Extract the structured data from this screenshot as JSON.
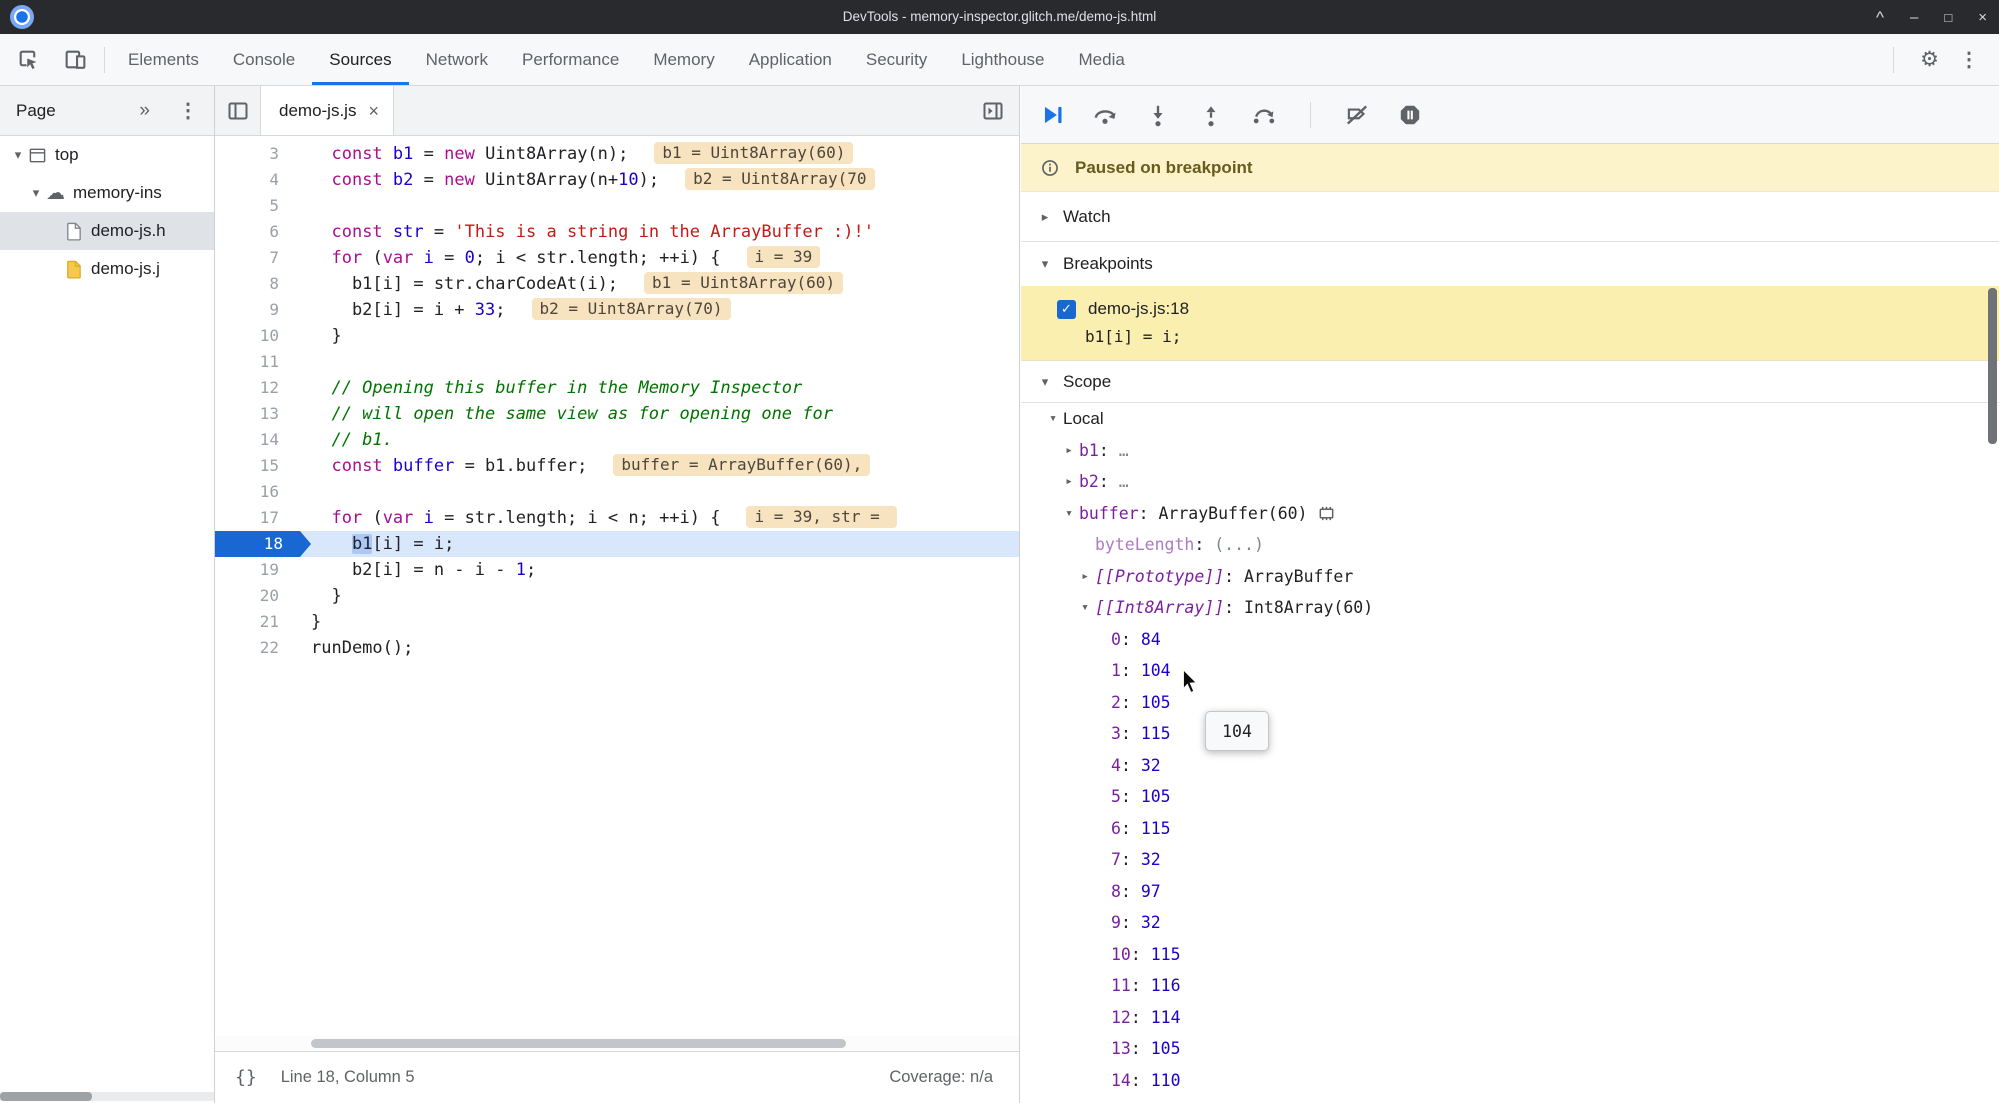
{
  "window": {
    "title": "DevTools - memory-inspector.glitch.me/demo-js.html"
  },
  "colors": {
    "accent": "#1a73e8",
    "paused_banner_bg": "#fcf3cb",
    "breakpoint_item_bg": "#faefae",
    "eval_badge_bg": "#f8e3c1",
    "current_line_bg": "#d9e7fd"
  },
  "main_toolbar": {
    "tabs": [
      "Elements",
      "Console",
      "Sources",
      "Network",
      "Performance",
      "Memory",
      "Application",
      "Security",
      "Lighthouse",
      "Media"
    ],
    "active_tab": "Sources"
  },
  "sidebar": {
    "tab_label": "Page",
    "tree": [
      {
        "label": "top",
        "icon": "frame",
        "indent": 0,
        "arrow": "down",
        "selected": false
      },
      {
        "label": "memory-ins",
        "icon": "cloud",
        "indent": 1,
        "arrow": "down",
        "selected": false
      },
      {
        "label": "demo-js.h",
        "icon": "file",
        "indent": 2,
        "arrow": "none",
        "selected": true
      },
      {
        "label": "demo-js.j",
        "icon": "file-js",
        "indent": 2,
        "arrow": "none",
        "selected": false
      }
    ]
  },
  "editor": {
    "tab_label": "demo-js.js",
    "status": {
      "position": "Line 18, Column 5",
      "coverage": "Coverage: n/a"
    },
    "lines": [
      {
        "num": 3,
        "tokens": [
          [
            "pl",
            "  "
          ],
          [
            "kw",
            "const"
          ],
          [
            "pl",
            " "
          ],
          [
            "def",
            "b1"
          ],
          [
            "pl",
            " = "
          ],
          [
            "kw",
            "new"
          ],
          [
            "pl",
            " Uint8Array(n);"
          ]
        ],
        "badge": "b1 = Uint8Array(60)"
      },
      {
        "num": 4,
        "tokens": [
          [
            "pl",
            "  "
          ],
          [
            "kw",
            "const"
          ],
          [
            "pl",
            " "
          ],
          [
            "def",
            "b2"
          ],
          [
            "pl",
            " = "
          ],
          [
            "kw",
            "new"
          ],
          [
            "pl",
            " Uint8Array(n+"
          ],
          [
            "num",
            "10"
          ],
          [
            "pl",
            ");"
          ]
        ],
        "badge": "b2 = Uint8Array(70"
      },
      {
        "num": 5,
        "tokens": []
      },
      {
        "num": 6,
        "tokens": [
          [
            "pl",
            "  "
          ],
          [
            "kw",
            "const"
          ],
          [
            "pl",
            " "
          ],
          [
            "def",
            "str"
          ],
          [
            "pl",
            " = "
          ],
          [
            "str",
            "'This is a string in the ArrayBuffer :)!'"
          ]
        ]
      },
      {
        "num": 7,
        "tokens": [
          [
            "pl",
            "  "
          ],
          [
            "kw",
            "for"
          ],
          [
            "pl",
            " ("
          ],
          [
            "kw",
            "var"
          ],
          [
            "pl",
            " "
          ],
          [
            "def",
            "i"
          ],
          [
            "pl",
            " = "
          ],
          [
            "num",
            "0"
          ],
          [
            "pl",
            "; i < str.length; ++i) {"
          ]
        ],
        "badge": "i = 39"
      },
      {
        "num": 8,
        "tokens": [
          [
            "pl",
            "    b1[i] = str.charCodeAt(i);"
          ]
        ],
        "badge": "b1 = Uint8Array(60)"
      },
      {
        "num": 9,
        "tokens": [
          [
            "pl",
            "    b2[i] = i + "
          ],
          [
            "num",
            "33"
          ],
          [
            "pl",
            ";"
          ]
        ],
        "badge": "b2 = Uint8Array(70)"
      },
      {
        "num": 10,
        "tokens": [
          [
            "pl",
            "  }"
          ]
        ]
      },
      {
        "num": 11,
        "tokens": []
      },
      {
        "num": 12,
        "tokens": [
          [
            "cmt",
            "  // Opening this buffer in the Memory Inspector"
          ]
        ]
      },
      {
        "num": 13,
        "tokens": [
          [
            "cmt",
            "  // will open the same view as for opening one for"
          ]
        ]
      },
      {
        "num": 14,
        "tokens": [
          [
            "cmt",
            "  // b1."
          ]
        ]
      },
      {
        "num": 15,
        "tokens": [
          [
            "pl",
            "  "
          ],
          [
            "kw",
            "const"
          ],
          [
            "pl",
            " "
          ],
          [
            "def",
            "buffer"
          ],
          [
            "pl",
            " = b1.buffer;"
          ]
        ],
        "badge": "buffer = ArrayBuffer(60),"
      },
      {
        "num": 16,
        "tokens": []
      },
      {
        "num": 17,
        "tokens": [
          [
            "pl",
            "  "
          ],
          [
            "kw",
            "for"
          ],
          [
            "pl",
            " ("
          ],
          [
            "kw",
            "var"
          ],
          [
            "pl",
            " "
          ],
          [
            "def",
            "i"
          ],
          [
            "pl",
            " = str.length; i < n; ++i) {"
          ]
        ],
        "badge": "i = 39, str = "
      },
      {
        "num": 18,
        "current": true,
        "tokens": [
          [
            "pl",
            "    "
          ],
          [
            "hl",
            "b1"
          ],
          [
            "pl",
            "[i] = i;"
          ]
        ]
      },
      {
        "num": 19,
        "tokens": [
          [
            "pl",
            "    b2[i] = n - i - "
          ],
          [
            "num",
            "1"
          ],
          [
            "pl",
            ";"
          ]
        ]
      },
      {
        "num": 20,
        "tokens": [
          [
            "pl",
            "  }"
          ]
        ]
      },
      {
        "num": 21,
        "tokens": [
          [
            "pl",
            "}"
          ]
        ]
      },
      {
        "num": 22,
        "tokens": [
          [
            "pl",
            "runDemo();"
          ]
        ]
      }
    ]
  },
  "debugger": {
    "toolbar_buttons": [
      "resume",
      "step-over",
      "step-into",
      "step-out",
      "step",
      "deactivate-breakpoints",
      "pause-on-exceptions"
    ],
    "paused_message": "Paused on breakpoint",
    "watch_label": "Watch",
    "breakpoints_label": "Breakpoints",
    "scope_label": "Scope",
    "breakpoint": {
      "checked": true,
      "location": "demo-js.js:18",
      "code": "b1[i] = i;"
    },
    "tooltip": "104",
    "scope_rows": [
      {
        "indent": 0,
        "arrow": "down",
        "name": "Local",
        "name_class": "section",
        "value": null
      },
      {
        "indent": 1,
        "arrow": "right",
        "name": "b1",
        "name_class": "var",
        "value": "…",
        "value_class": "dim"
      },
      {
        "indent": 1,
        "arrow": "right",
        "name": "b2",
        "name_class": "var",
        "value": "…",
        "value_class": "dim"
      },
      {
        "indent": 1,
        "arrow": "down",
        "name": "buffer",
        "name_class": "var",
        "value": "ArrayBuffer(60)",
        "value_class": "obj",
        "icon": "memory"
      },
      {
        "indent": 2,
        "arrow": "none",
        "name": "byteLength",
        "name_class": "getter",
        "value": "(...)",
        "value_class": "dim"
      },
      {
        "indent": 2,
        "arrow": "right",
        "name": "[[Prototype]]",
        "name_class": "internal",
        "value": "ArrayBuffer",
        "value_class": "obj"
      },
      {
        "indent": 2,
        "arrow": "down",
        "name": "[[Int8Array]]",
        "name_class": "internal",
        "value": "Int8Array(60)",
        "value_class": "obj"
      },
      {
        "indent": 3,
        "arrow": "none",
        "name": "0",
        "name_class": "var",
        "value": "84",
        "value_class": "num"
      },
      {
        "indent": 3,
        "arrow": "none",
        "name": "1",
        "name_class": "var",
        "value": "104",
        "value_class": "num"
      },
      {
        "indent": 3,
        "arrow": "none",
        "name": "2",
        "name_class": "var",
        "value": "105",
        "value_class": "num"
      },
      {
        "indent": 3,
        "arrow": "none",
        "name": "3",
        "name_class": "var",
        "value": "115",
        "value_class": "num"
      },
      {
        "indent": 3,
        "arrow": "none",
        "name": "4",
        "name_class": "var",
        "value": "32",
        "value_class": "num"
      },
      {
        "indent": 3,
        "arrow": "none",
        "name": "5",
        "name_class": "var",
        "value": "105",
        "value_class": "num"
      },
      {
        "indent": 3,
        "arrow": "none",
        "name": "6",
        "name_class": "var",
        "value": "115",
        "value_class": "num"
      },
      {
        "indent": 3,
        "arrow": "none",
        "name": "7",
        "name_class": "var",
        "value": "32",
        "value_class": "num"
      },
      {
        "indent": 3,
        "arrow": "none",
        "name": "8",
        "name_class": "var",
        "value": "97",
        "value_class": "num"
      },
      {
        "indent": 3,
        "arrow": "none",
        "name": "9",
        "name_class": "var",
        "value": "32",
        "value_class": "num"
      },
      {
        "indent": 3,
        "arrow": "none",
        "name": "10",
        "name_class": "var",
        "value": "115",
        "value_class": "num"
      },
      {
        "indent": 3,
        "arrow": "none",
        "name": "11",
        "name_class": "var",
        "value": "116",
        "value_class": "num"
      },
      {
        "indent": 3,
        "arrow": "none",
        "name": "12",
        "name_class": "var",
        "value": "114",
        "value_class": "num"
      },
      {
        "indent": 3,
        "arrow": "none",
        "name": "13",
        "name_class": "var",
        "value": "105",
        "value_class": "num"
      },
      {
        "indent": 3,
        "arrow": "none",
        "name": "14",
        "name_class": "var",
        "value": "110",
        "value_class": "num"
      }
    ]
  }
}
